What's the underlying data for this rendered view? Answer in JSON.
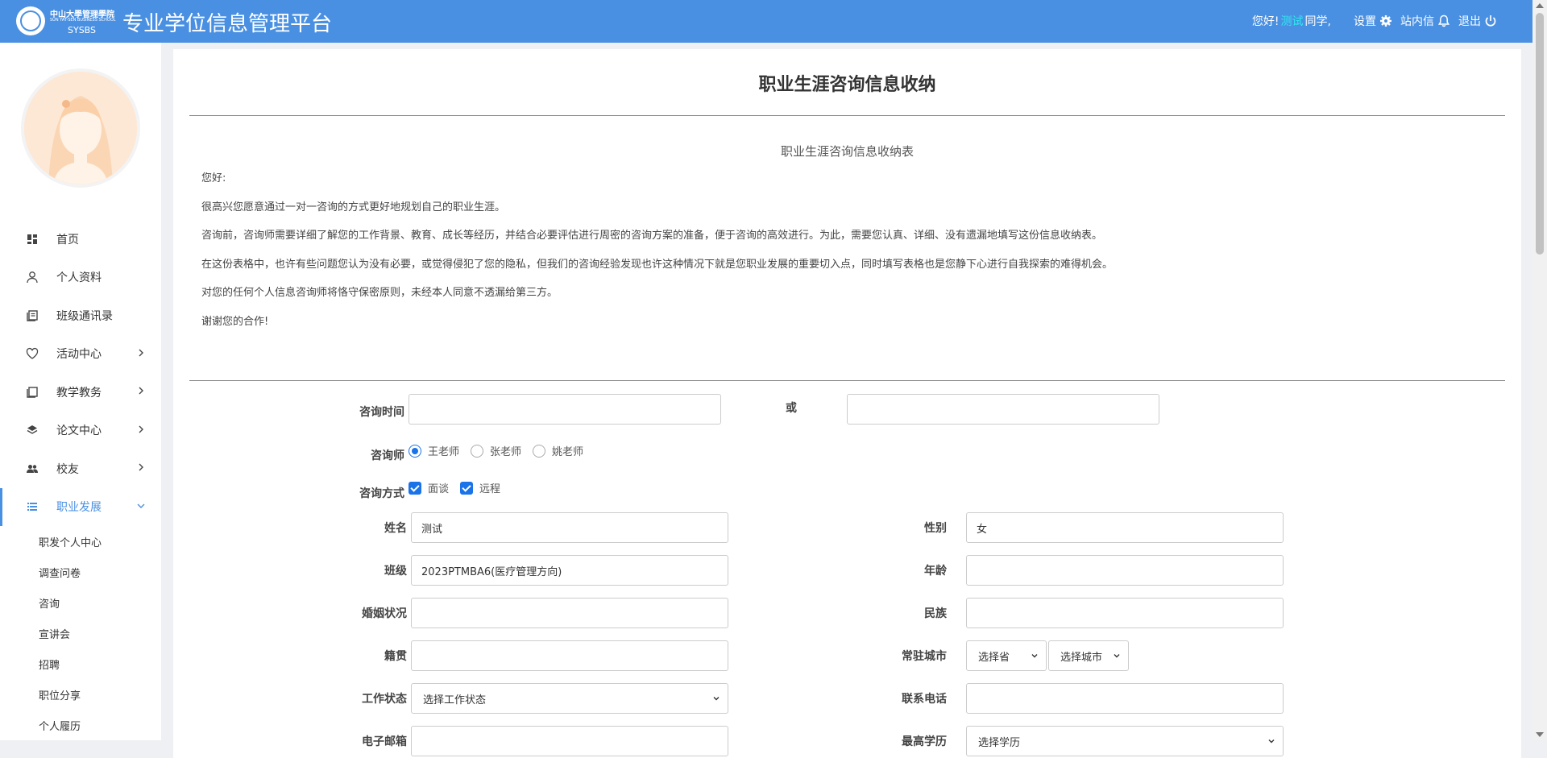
{
  "header": {
    "logo_line1": "中山大學管理學院",
    "logo_line2": "SUN YAT-SEN BUSINESS SCHOOL",
    "logo_line3": "SYSBS",
    "platform_title": "专业学位信息管理平台",
    "greeting_prefix": "您好!",
    "user_name": "测试",
    "greeting_suffix": "同学,",
    "settings_label": "设置",
    "messages_label": "站内信",
    "logout_label": "退出"
  },
  "sidebar": {
    "items": [
      {
        "label": "首页",
        "icon": "dashboard-icon"
      },
      {
        "label": "个人资料",
        "icon": "user-icon"
      },
      {
        "label": "班级通讯录",
        "icon": "contacts-book-icon"
      },
      {
        "label": "活动中心",
        "icon": "heart-icon"
      },
      {
        "label": "教学教务",
        "icon": "book-icon"
      },
      {
        "label": "论文中心",
        "icon": "layers-icon"
      },
      {
        "label": "校友",
        "icon": "users-icon"
      },
      {
        "label": "职业发展",
        "icon": "list-icon"
      }
    ],
    "sub_items": [
      "职发个人中心",
      "调查问卷",
      "咨询",
      "宣讲会",
      "招聘",
      "职位分享",
      "个人履历"
    ]
  },
  "main": {
    "title": "职业生涯咨询信息收纳",
    "form_title": "职业生涯咨询信息收纳表",
    "intro": [
      "您好:",
      "很高兴您愿意通过一对一咨询的方式更好地规划自己的职业生涯。",
      "咨询前，咨询师需要详细了解您的工作背景、教育、成长等经历，并结合必要评估进行周密的咨询方案的准备，便于咨询的高效进行。为此，需要您认真、详细、没有遗漏地填写这份信息收纳表。",
      "在这份表格中，也许有些问题您认为没有必要，或觉得侵犯了您的隐私，但我们的咨询经验发现也许这种情况下就是您职业发展的重要切入点，同时填写表格也是您静下心进行自我探索的难得机会。",
      "对您的任何个人信息咨询师将恪守保密原则，未经本人同意不透漏给第三方。",
      "谢谢您的合作!"
    ]
  },
  "form": {
    "consult_time_label": "咨询时间",
    "or_label": "或",
    "consultant_label": "咨询师",
    "consultants": [
      "王老师",
      "张老师",
      "姚老师"
    ],
    "selected_consultant": "王老师",
    "method_label": "咨询方式",
    "methods": [
      "面谈",
      "远程"
    ],
    "name_label": "姓名",
    "name_value": "测试",
    "gender_label": "性别",
    "gender_value": "女",
    "class_label": "班级",
    "class_value": "2023PTMBA6(医疗管理方向)",
    "age_label": "年龄",
    "marital_label": "婚姻状况",
    "ethnicity_label": "民族",
    "native_label": "籍贯",
    "city_label": "常驻城市",
    "province_select": "选择省",
    "city_select": "选择城市",
    "work_status_label": "工作状态",
    "work_status_select": "选择工作状态",
    "phone_label": "联系电话",
    "email_label": "电子邮箱",
    "education_label": "最高学历",
    "education_select": "选择学历"
  }
}
